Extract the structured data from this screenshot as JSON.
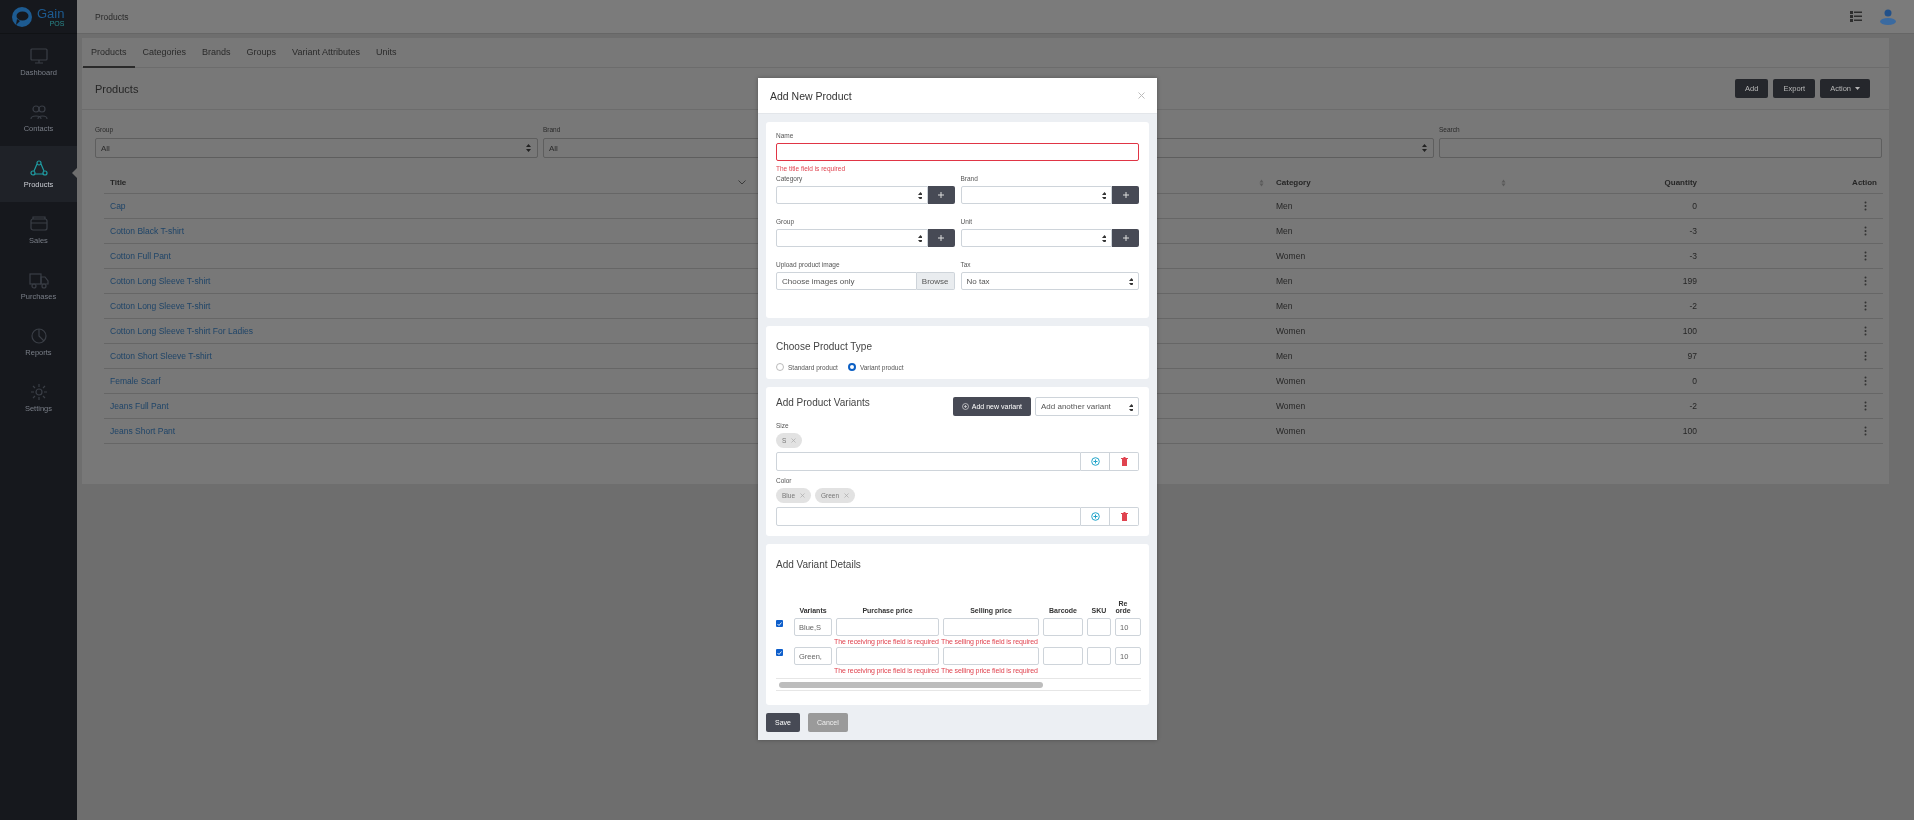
{
  "app": {
    "logo": "Gain",
    "logo_sub": "POS"
  },
  "sidebar": {
    "items": [
      {
        "label": "Dashboard",
        "selected": false
      },
      {
        "label": "Contacts",
        "selected": false
      },
      {
        "label": "Products",
        "selected": true
      },
      {
        "label": "Sales",
        "selected": false
      },
      {
        "label": "Purchases",
        "selected": false
      },
      {
        "label": "Reports",
        "selected": false
      },
      {
        "label": "Settings",
        "selected": false
      }
    ]
  },
  "topbar": {
    "title": "Products"
  },
  "tabs": [
    {
      "label": "Products",
      "selected": true
    },
    {
      "label": "Categories",
      "selected": false
    },
    {
      "label": "Brands",
      "selected": false
    },
    {
      "label": "Groups",
      "selected": false
    },
    {
      "label": "Variant Attributes",
      "selected": false
    },
    {
      "label": "Units",
      "selected": false
    }
  ],
  "page": {
    "title": "Products",
    "buttons": [
      {
        "label": "Add",
        "kind": "button"
      },
      {
        "label": "Export",
        "kind": "button"
      },
      {
        "label": "Action",
        "kind": "dropdown"
      }
    ]
  },
  "filters": [
    {
      "label": "Group",
      "kind": "select",
      "value": "All"
    },
    {
      "label": "Brand",
      "kind": "select",
      "value": "All"
    },
    {
      "kind": "select"
    },
    {
      "label": "Search",
      "kind": "search"
    }
  ],
  "table": {
    "columns": [
      {
        "label": "Title"
      },
      {},
      {
        "label": "Category"
      },
      {
        "label": "Quantity"
      },
      {
        "label": "Action"
      }
    ],
    "rows": [
      {
        "title": "Cap",
        "category": "Men",
        "quantity": "0"
      },
      {
        "title": "Cotton Black T-shirt",
        "category": "Men",
        "quantity": "-3"
      },
      {
        "title": "Cotton Full Pant",
        "category": "Women",
        "quantity": "-3"
      },
      {
        "title": "Cotton Long Sleeve T-shirt",
        "category": "Men",
        "quantity": "199"
      },
      {
        "title": "Cotton Long Sleeve T-shirt",
        "category": "Men",
        "quantity": "-2"
      },
      {
        "title": "Cotton Long Sleeve T-shirt For Ladies",
        "category": "Women",
        "quantity": "100"
      },
      {
        "title": "Cotton Short Sleeve T-shirt",
        "category": "Men",
        "quantity": "97"
      },
      {
        "title": "Female Scarf",
        "category": "Women",
        "quantity": "0"
      },
      {
        "title": "Jeans Full Pant",
        "category": "Women",
        "quantity": "-2"
      },
      {
        "title": "Jeans Short Pant",
        "category": "Women",
        "quantity": "100"
      }
    ]
  },
  "modal": {
    "title": "Add New Product",
    "name": {
      "label": "Name",
      "error": "The title field is required"
    },
    "fields": [
      {
        "label": "Category",
        "kind": "select-add"
      },
      {
        "label": "Brand",
        "kind": "select-add"
      },
      {
        "label": "Group",
        "kind": "select-add"
      },
      {
        "label": "Unit",
        "kind": "select-add"
      },
      {
        "label": "Upload product image",
        "kind": "file",
        "placeholder": "Choose images only",
        "button": "Browse"
      },
      {
        "label": "Tax",
        "kind": "select",
        "value": "No tax"
      }
    ],
    "product_type": {
      "title": "Choose Product Type",
      "options": [
        {
          "label": "Standard product",
          "selected": false
        },
        {
          "label": "Variant product",
          "selected": true
        }
      ]
    },
    "variants": {
      "title": "Add Product Variants",
      "add_button": "Add new variant",
      "select": "Add another variant",
      "attributes": [
        {
          "label": "Size",
          "values": [
            "S"
          ]
        },
        {
          "label": "Color",
          "values": [
            "Blue",
            "Green"
          ]
        }
      ]
    },
    "variant_details": {
      "title": "Add Variant Details",
      "columns": [
        "Variants",
        "Purchase price",
        "Selling price",
        "Barcode",
        "SKU",
        "Re orde"
      ],
      "rows": [
        {
          "checked": true,
          "variant": "Blue,S",
          "purchase_error": "The receiving price field is required",
          "selling_error": "The selling price field is required",
          "reorder": "10"
        },
        {
          "checked": true,
          "variant": "Green,",
          "purchase_error": "The receiving price field is required",
          "selling_error": "The selling price field is required",
          "reorder": "10"
        }
      ]
    },
    "buttons": [
      {
        "label": "Save",
        "kind": "primary"
      },
      {
        "label": "Cancel",
        "kind": "secondary"
      }
    ]
  }
}
